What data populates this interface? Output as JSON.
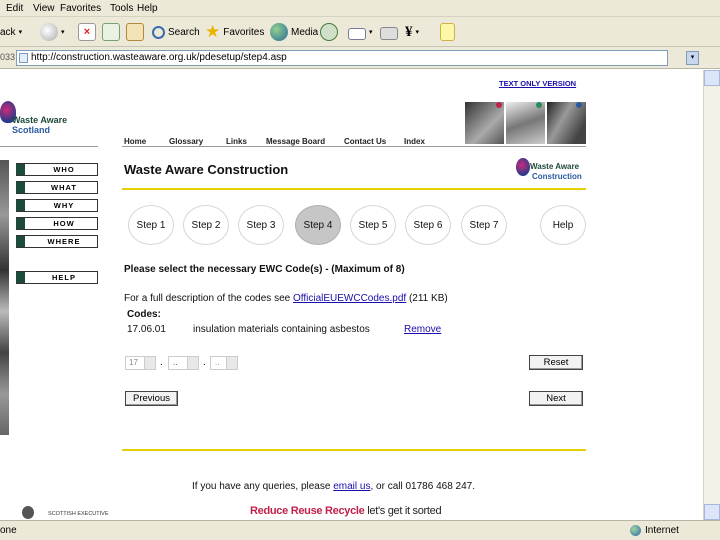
{
  "menubar": [
    "Edit",
    "View",
    "Favorites",
    "Tools",
    "Help"
  ],
  "toolbar": {
    "back_label": "ack",
    "search_label": "Search",
    "favorites_label": "Favorites",
    "media_label": "Media"
  },
  "address": {
    "url": "http://construction.wasteaware.org.uk/pdesetup/step4.asp"
  },
  "status": {
    "left": "one",
    "zone": "Internet"
  },
  "site": {
    "text_only": "TEXT ONLY VERSION",
    "logo_line1": "Waste Aware",
    "logo_line2": "Scotland",
    "top_nav": [
      "Home",
      "Glossary",
      "Links",
      "Message Board",
      "Contact Us",
      "Index"
    ],
    "side_nav": [
      "WHO",
      "WHAT",
      "WHY",
      "HOW",
      "WHERE",
      "HELP"
    ],
    "heading": "Waste Aware Construction",
    "logo2_line1": "Waste Aware",
    "logo2_line2": "Construction",
    "steps": [
      "Step 1",
      "Step 2",
      "Step 3",
      "Step 4",
      "Step 5",
      "Step 6",
      "Step 7",
      "Help"
    ],
    "instruction": "Please select the necessary EWC Code(s) - (Maximum of 8)",
    "desc_prefix": "For a full description of the codes see",
    "desc_link": "OfficialEUEWCCodes.pdf",
    "desc_suffix": "(211 KB)",
    "codes_label": "Codes:",
    "code_value": "17.06.01",
    "code_desc": "insulation materials containing asbestos",
    "remove_label": "Remove",
    "select1": "17",
    "select2": "..",
    "select3": "..",
    "dot": ".",
    "reset_label": "Reset",
    "previous_label": "Previous",
    "next_label": "Next",
    "footer_prefix": "If you have any queries, please",
    "footer_link": "email us",
    "footer_suffix": ", or call 01786 468 247.",
    "exec_label": "SCOTTISH EXECUTIVE",
    "slogan_reduce": "Reduce",
    "slogan_reuse": "Reuse",
    "slogan_recycle": "Recycle",
    "slogan_rest": "let's get it sorted"
  },
  "colors": {
    "chrome": "#ece9d8",
    "brand_green": "#1d4a3a",
    "brand_blue": "#2a5aa0",
    "link_blue": "#1a0dab",
    "rule_yellow": "#e5d000"
  }
}
